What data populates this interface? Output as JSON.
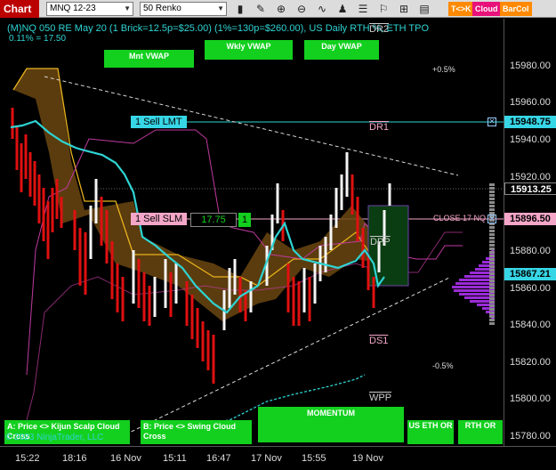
{
  "toolbar": {
    "title": "Chart",
    "instrument": "MNQ 12-23",
    "bar_type": "50 Renko",
    "btn_tk": "T<>K",
    "btn_cloud": "Cloud",
    "btn_barcol": "BarCol",
    "icons": [
      "bar-style-icon",
      "drawing-tools-icon",
      "zoom-in-icon",
      "zoom-out-icon",
      "indicators-icon",
      "strategies-icon",
      "properties-icon",
      "alert-icon",
      "chart-trader-icon"
    ]
  },
  "chart": {
    "header": "(M)NQ 050 RE May 20 (1 Brick=12.5p=$25.00) (1%=130p=$260.00), US Daily RTH %, ETH TPO",
    "sub": "0.11% = 17.50",
    "vwap_buttons": [
      "Mnt VWAP",
      "Wkly VWAP",
      "Day VWAP"
    ],
    "sell_lmt": "1 Sell LMT",
    "sell_slm": "1 Sell SLM",
    "slm_value": "17.75",
    "slm_qty": "1",
    "close_label": "CLOSE 17 NQ",
    "levels": {
      "dr2": "DR2",
      "dr1": "DR1",
      "dpp": "DPP",
      "ds1": "DS1",
      "wpp": "WPP"
    },
    "pct_top": "+0.5%",
    "pct_bottom": "-0.5%",
    "copyright": "© 2023 NinjaTrader, LLC",
    "bottom_buttons": {
      "a": "A: Price <> Kijun Scalp Cloud Cross",
      "b": "B: Price <> Swing Cloud Cross",
      "momentum": "MOMENTUM",
      "us_eth": "US ETH OR",
      "rth": "RTH OR"
    }
  },
  "price_axis": {
    "ticks": [
      "15980.00",
      "15960.00",
      "15940.00",
      "15920.00",
      "15880.00",
      "15860.00",
      "15840.00",
      "15820.00",
      "15800.00",
      "15780.00"
    ],
    "tags": {
      "sell_lmt": "15948.75",
      "last": "15913.25",
      "close": "15896.50",
      "cyan": "15867.21"
    }
  },
  "time_axis": [
    "15:22",
    "18:16",
    "16 Nov",
    "15:11",
    "16:47",
    "17 Nov",
    "15:55",
    "19 Nov"
  ],
  "colors": {
    "cyan": "#2fd3d3",
    "green": "#13d01f",
    "red": "#e01010",
    "pink": "#f4a6c8",
    "purple": "#9a2bd6",
    "magenta": "#c03aa0",
    "gold": "#e8b21c",
    "brown": "#7a5212"
  }
}
